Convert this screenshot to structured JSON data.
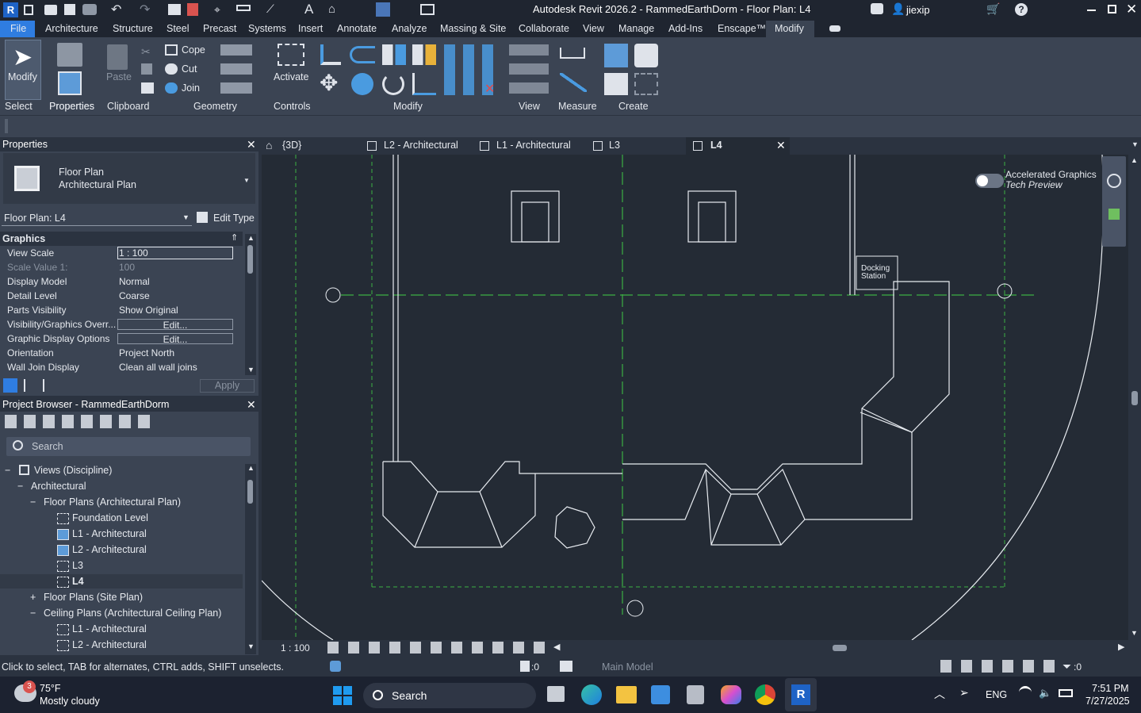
{
  "window": {
    "title": "Autodesk Revit 2026.2 - RammedEarthDorm - Floor Plan: L4",
    "user": "jiexip"
  },
  "ribbon_tabs": [
    "File",
    "Architecture",
    "Structure",
    "Steel",
    "Precast",
    "Systems",
    "Insert",
    "Annotate",
    "Analyze",
    "Massing & Site",
    "Collaborate",
    "View",
    "Manage",
    "Add-Ins",
    "Enscape™",
    "Modify"
  ],
  "ribbon": {
    "modify_label": "Modify",
    "properties_label": "Properties",
    "paste_label": "Paste",
    "activate_label": "Activate",
    "cope_label": "Cope",
    "cut_label": "Cut",
    "join_label": "Join",
    "groups": [
      "Select",
      "Properties",
      "Clipboard",
      "Geometry",
      "Controls",
      "Modify",
      "View",
      "Measure",
      "Create"
    ]
  },
  "properties": {
    "title": "Properties",
    "type_name": "Floor Plan",
    "type_sub": "Architectural Plan",
    "instance": "Floor Plan: L4",
    "edit_type": "Edit Type",
    "section": "Graphics",
    "rows": [
      {
        "k": "View Scale",
        "v": "1 : 100"
      },
      {
        "k": "Scale Value    1:",
        "v": "100"
      },
      {
        "k": "Display Model",
        "v": "Normal"
      },
      {
        "k": "Detail Level",
        "v": "Coarse"
      },
      {
        "k": "Parts Visibility",
        "v": "Show Original"
      },
      {
        "k": "Visibility/Graphics Overr...",
        "v": "Edit..."
      },
      {
        "k": "Graphic Display Options",
        "v": "Edit..."
      },
      {
        "k": "Orientation",
        "v": "Project North"
      },
      {
        "k": "Wall Join Display",
        "v": "Clean all wall joins"
      }
    ],
    "apply": "Apply"
  },
  "browser": {
    "title": "Project Browser - RammedEarthDorm",
    "search_placeholder": "Search",
    "items": [
      "Views (Discipline)",
      "Architectural",
      "Floor Plans (Architectural Plan)",
      "Foundation Level",
      "L1 - Architectural",
      "L2 - Architectural",
      "L3",
      "L4",
      "Floor Plans (Site Plan)",
      "Ceiling Plans (Architectural Ceiling Plan)",
      "L1 - Architectural",
      "L2 - Architectural"
    ]
  },
  "doc_tabs": [
    "{3D}",
    "L2 - Architectural",
    "L1 - Architectural",
    "L3",
    "L4"
  ],
  "canvas": {
    "toggle_label_1": "Accelerated Graphics",
    "toggle_label_2": "Tech Preview",
    "docking_1": "Docking",
    "docking_2": "Station"
  },
  "viewbar": {
    "scale": "1 : 100"
  },
  "status": {
    "hint": "Click to select, TAB for alternates, CTRL adds, SHIFT unselects.",
    "count": ":0",
    "model": "Main Model",
    "filter": ":0"
  },
  "taskbar": {
    "temp": "75°F",
    "weather": "Mostly cloudy",
    "badge": "3",
    "search": "Search",
    "lang": "ENG",
    "time": "7:51 PM",
    "date": "7/27/2025"
  },
  "colors": {
    "accent": "#2f7de1",
    "grid": "#3cb043",
    "canvas": "#242b35"
  }
}
